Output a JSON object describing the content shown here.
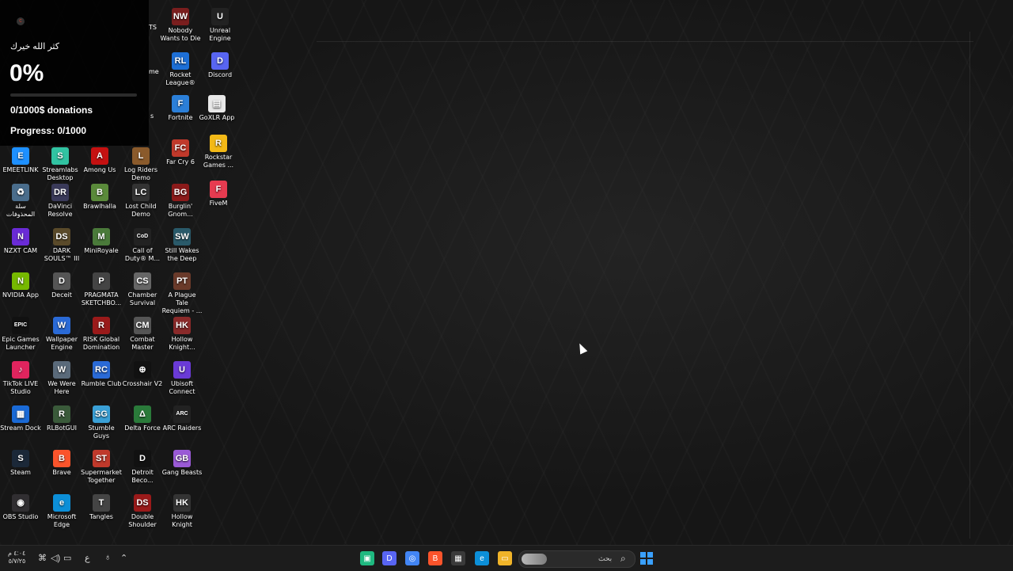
{
  "overlay": {
    "thanks": "كثر الله خيرك",
    "percent": "0%",
    "progress_fraction": 0,
    "donations": "0/1000$ donations",
    "progress": "Progress: 0/1000",
    "edge_fragments": [
      "TS",
      "me",
      "s"
    ]
  },
  "desktop": {
    "icons": [
      {
        "name": "nobody-wants-to-die-icon",
        "label": "Nobody Wants to Die",
        "glyph": "NW",
        "color": "#7a1e1e"
      },
      {
        "name": "unreal-engine-icon",
        "label": "Unreal Engine",
        "glyph": "U",
        "color": "#222222"
      },
      {
        "name": "rocket-league-icon",
        "label": "Rocket League®",
        "glyph": "RL",
        "color": "#1d6fd6"
      },
      {
        "name": "discord-icon",
        "label": "Discord",
        "glyph": "D",
        "color": "#5865f2"
      },
      {
        "name": "fortnite-icon",
        "label": "Fortnite",
        "glyph": "F",
        "color": "#2b7fd8"
      },
      {
        "name": "goxlr-app-icon",
        "label": "GoXLR App",
        "glyph": "▤",
        "color": "#e8e8e8"
      },
      {
        "name": "far-cry-6-icon",
        "label": "Far Cry 6",
        "glyph": "FC",
        "color": "#c0392b"
      },
      {
        "name": "rockstar-games-icon",
        "label": "Rockstar Games ...",
        "glyph": "R",
        "color": "#f3b917"
      },
      {
        "name": "fivem-icon",
        "label": "FiveM",
        "glyph": "F",
        "color": "#e63b50"
      },
      {
        "name": "emeetlink-icon",
        "label": "EMEETLINK",
        "glyph": "E",
        "color": "#1e90ff"
      },
      {
        "name": "streamlabs-icon",
        "label": "Streamlabs Desktop",
        "glyph": "S",
        "color": "#31c3a2"
      },
      {
        "name": "among-us-icon",
        "label": "Among Us",
        "glyph": "A",
        "color": "#c51111"
      },
      {
        "name": "log-riders-icon",
        "label": "Log Riders Demo",
        "glyph": "L",
        "color": "#8a5a2b"
      },
      {
        "name": "recycle-bin-icon",
        "label": "سلة المحذوفات",
        "glyph": "♻",
        "color": "#4a6d8c"
      },
      {
        "name": "davinci-resolve-icon",
        "label": "DaVinci Resolve",
        "glyph": "DR",
        "color": "#3a3a5a"
      },
      {
        "name": "brawlhalla-icon",
        "label": "Brawlhalla",
        "glyph": "B",
        "color": "#5a8a3a"
      },
      {
        "name": "lost-child-icon",
        "label": "Lost Child Demo",
        "glyph": "LC",
        "color": "#333333"
      },
      {
        "name": "burglin-gnomes-icon",
        "label": "Burglin' Gnom...",
        "glyph": "BG",
        "color": "#8b1a1a"
      },
      {
        "name": "nzxt-cam-icon",
        "label": "NZXT CAM",
        "glyph": "N",
        "color": "#6a2bd6"
      },
      {
        "name": "dark-souls-icon",
        "label": "DARK SOULS™ III",
        "glyph": "DS",
        "color": "#5a4a2a"
      },
      {
        "name": "miniroyale-icon",
        "label": "MiniRoyale",
        "glyph": "M",
        "color": "#4a7a3a"
      },
      {
        "name": "call-of-duty-icon",
        "label": "Call of Duty® M...",
        "glyph": "CoD",
        "color": "#222222"
      },
      {
        "name": "still-wakes-icon",
        "label": "Still Wakes the Deep",
        "glyph": "SW",
        "color": "#2a5a6a"
      },
      {
        "name": "nvidia-app-icon",
        "label": "NVIDIA App",
        "glyph": "N",
        "color": "#76b900"
      },
      {
        "name": "deceit-icon",
        "label": "Deceit",
        "glyph": "D",
        "color": "#555555"
      },
      {
        "name": "pragmata-icon",
        "label": "PRAGMATA SKETCHBO...",
        "glyph": "P",
        "color": "#444444"
      },
      {
        "name": "chamber-survival-icon",
        "label": "Chamber Survival",
        "glyph": "CS",
        "color": "#666666"
      },
      {
        "name": "plague-tale-icon",
        "label": "A Plague Tale Requiem - ...",
        "glyph": "PT",
        "color": "#6a3a2a"
      },
      {
        "name": "epic-games-icon",
        "label": "Epic Games Launcher",
        "glyph": "EPIC",
        "color": "#111111"
      },
      {
        "name": "wallpaper-engine-icon",
        "label": "Wallpaper Engine",
        "glyph": "W",
        "color": "#2a6ad6"
      },
      {
        "name": "risk-global-domination-icon",
        "label": "RISK Global Domination",
        "glyph": "R",
        "color": "#9a1a1a"
      },
      {
        "name": "combat-master-icon",
        "label": "Combat Master",
        "glyph": "CM",
        "color": "#555555"
      },
      {
        "name": "hollow-knight-silksong-icon",
        "label": "Hollow Knight...",
        "glyph": "HK",
        "color": "#8a2a2a"
      },
      {
        "name": "tiktok-live-studio-icon",
        "label": "TikTok LIVE Studio",
        "glyph": "♪",
        "color": "#e0245e"
      },
      {
        "name": "we-were-here-icon",
        "label": "We Were Here",
        "glyph": "W",
        "color": "#5a6a7a"
      },
      {
        "name": "rumble-club-icon",
        "label": "Rumble Club",
        "glyph": "RC",
        "color": "#2a6ad6"
      },
      {
        "name": "crosshair-v2-icon",
        "label": "Crosshair V2",
        "glyph": "⊕",
        "color": "#111111"
      },
      {
        "name": "ubisoft-connect-icon",
        "label": "Ubisoft Connect",
        "glyph": "U",
        "color": "#6a3ad6"
      },
      {
        "name": "stream-dock-icon",
        "label": "Stream Dock",
        "glyph": "▦",
        "color": "#1a6ad6"
      },
      {
        "name": "rlbotgui-icon",
        "label": "RLBotGUI",
        "glyph": "R",
        "color": "#3a5a3a"
      },
      {
        "name": "stumble-guys-icon",
        "label": "Stumble Guys",
        "glyph": "SG",
        "color": "#3aa0d6"
      },
      {
        "name": "delta-force-icon",
        "label": "Delta Force",
        "glyph": "Δ",
        "color": "#2a7a3a"
      },
      {
        "name": "arc-raiders-icon",
        "label": "ARC Raiders",
        "glyph": "ARC",
        "color": "#222222"
      },
      {
        "name": "steam-icon",
        "label": "Steam",
        "glyph": "S",
        "color": "#1b2838"
      },
      {
        "name": "brave-icon",
        "label": "Brave",
        "glyph": "B",
        "color": "#fb542b"
      },
      {
        "name": "supermarket-together-icon",
        "label": "Supermarket Together",
        "glyph": "ST",
        "color": "#c0392b"
      },
      {
        "name": "detroit-icon",
        "label": "Detroit Beco...",
        "glyph": "D",
        "color": "#111111"
      },
      {
        "name": "gang-beasts-icon",
        "label": "Gang Beasts",
        "glyph": "GB",
        "color": "#9a5ad6"
      },
      {
        "name": "obs-studio-icon",
        "label": "OBS Studio",
        "glyph": "◉",
        "color": "#302e31"
      },
      {
        "name": "microsoft-edge-icon",
        "label": "Microsoft Edge",
        "glyph": "e",
        "color": "#0c8fd8"
      },
      {
        "name": "tangles-icon",
        "label": "Tangles",
        "glyph": "T",
        "color": "#444444"
      },
      {
        "name": "double-shoulder-icon",
        "label": "Double Shoulder",
        "glyph": "DS",
        "color": "#9a1a1a"
      },
      {
        "name": "hollow-knight-icon",
        "label": "Hollow Knight",
        "glyph": "HK",
        "color": "#333333"
      }
    ]
  },
  "taskbar": {
    "clock_time": "٤:٠٤ م",
    "clock_date": "٥/٧/٢٥",
    "language": "ع",
    "search_placeholder": "بحث",
    "search_icon": "search-icon",
    "start_icon": "windows-start-icon",
    "apps": [
      {
        "name": "terminal-icon",
        "glyph": "▣",
        "color": "#1fb980"
      },
      {
        "name": "discord-taskbar-icon",
        "glyph": "D",
        "color": "#5865f2"
      },
      {
        "name": "chrome-icon",
        "glyph": "◎",
        "color": "#4285f4"
      },
      {
        "name": "brave-taskbar-icon",
        "glyph": "B",
        "color": "#fb542b"
      },
      {
        "name": "microsoft-store-icon",
        "glyph": "▦",
        "color": "#3a3a3a"
      },
      {
        "name": "edge-taskbar-icon",
        "glyph": "e",
        "color": "#0c8fd8"
      },
      {
        "name": "file-explorer-icon",
        "glyph": "▭",
        "color": "#f0b429"
      }
    ]
  }
}
